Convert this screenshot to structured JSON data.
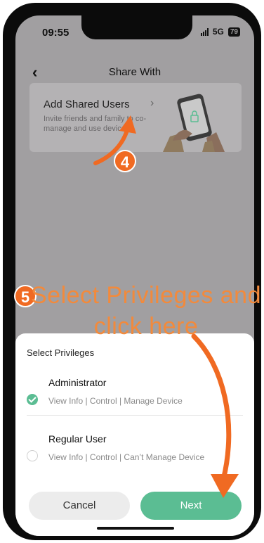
{
  "status_bar": {
    "time": "09:55",
    "network": "5G",
    "battery": "79"
  },
  "nav": {
    "title": "Share With"
  },
  "card": {
    "title": "Add Shared Users",
    "description": "Invite friends and family to co-manage and use device."
  },
  "sheet": {
    "title": "Select Privileges",
    "options": [
      {
        "label": "Administrator",
        "description": "View Info | Control | Manage Device",
        "selected": true
      },
      {
        "label": "Regular User",
        "description": "View Info | Control | Can’t Manage Device",
        "selected": false
      }
    ],
    "cancel_label": "Cancel",
    "next_label": "Next"
  },
  "annotations": {
    "step4": "4",
    "step5": "5",
    "instruction": "Select Privileges and click here",
    "accent_color": "#f06a22"
  },
  "colors": {
    "primary": "#5bbd93",
    "dimmed_background": "#a19fa1"
  }
}
